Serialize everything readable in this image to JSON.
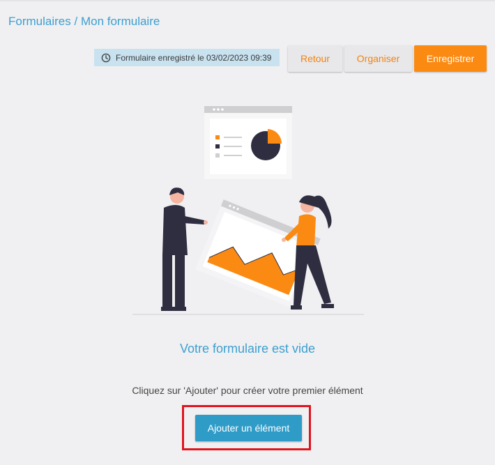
{
  "breadcrumb": {
    "root": "Formulaires",
    "separator": "/",
    "current": "Mon formulaire"
  },
  "status": {
    "icon": "clock-icon",
    "text": "Formulaire enregistré le 03/02/2023 09:39"
  },
  "toolbar": {
    "back_label": "Retour",
    "organize_label": "Organiser",
    "save_label": "Enregistrer"
  },
  "empty_state": {
    "title": "Votre formulaire est vide",
    "hint": "Cliquez sur 'Ajouter' pour créer votre premier élément",
    "add_button_label": "Ajouter un élément"
  },
  "colors": {
    "accent_orange": "#fb8a12",
    "accent_blue": "#3d9fd0",
    "button_blue": "#2f9cc8",
    "highlight_red": "#e0141e",
    "dark_figure": "#2f2e41"
  }
}
